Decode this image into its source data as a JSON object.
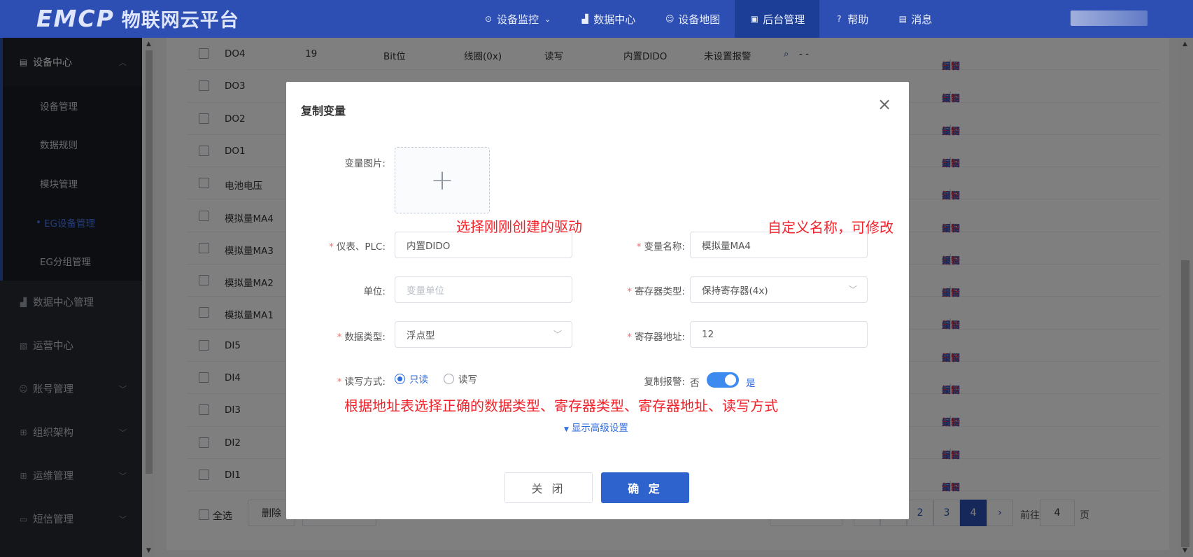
{
  "header": {
    "logo_text": "EMCP",
    "logo_cn": "物联网云平台",
    "nav": [
      {
        "label": "设备监控",
        "icon": "location-icon",
        "has_dropdown": true
      },
      {
        "label": "数据中心",
        "icon": "chart-icon"
      },
      {
        "label": "设备地图",
        "icon": "user-icon"
      },
      {
        "label": "后台管理",
        "icon": "monitor-icon",
        "active": true
      },
      {
        "label": "帮助",
        "icon": "help-icon"
      },
      {
        "label": "消息",
        "icon": "message-icon"
      }
    ]
  },
  "sidebar": {
    "open_group": "设备中心",
    "sub_items": [
      "设备管理",
      "数据规则",
      "模块管理",
      "EG设备管理",
      "EG分组管理"
    ],
    "active_sub": "EG设备管理",
    "groups": [
      {
        "label": "数据中心管理",
        "has_children": false
      },
      {
        "label": "运营中心",
        "has_children": false
      },
      {
        "label": "账号管理",
        "has_children": true
      },
      {
        "label": "组织架构",
        "has_children": true
      },
      {
        "label": "运维管理",
        "has_children": true
      },
      {
        "label": "短信管理",
        "has_children": true
      }
    ]
  },
  "table": {
    "rows": [
      {
        "name": "DO4",
        "address": "19",
        "data_type": "Bit位",
        "register": "线圈(0x)",
        "rw": "读写",
        "plc": "内置DIDO",
        "alarm": "未设置报警",
        "extra": "- -"
      },
      {
        "name": "DO3"
      },
      {
        "name": "DO2"
      },
      {
        "name": "DO1"
      },
      {
        "name": "电池电压"
      },
      {
        "name": "模拟量MA4"
      },
      {
        "name": "模拟量MA3"
      },
      {
        "name": "模拟量MA2"
      },
      {
        "name": "模拟量MA1"
      },
      {
        "name": "DI5"
      },
      {
        "name": "DI4"
      },
      {
        "name": "DI3"
      },
      {
        "name": "DI2"
      },
      {
        "name": "DI1"
      }
    ],
    "actions": {
      "edit": "编辑",
      "alarm": "报警",
      "copy": "复制",
      "delete": "删除"
    }
  },
  "footer": {
    "select_all": "全选",
    "delete": "删除",
    "pages": [
      "1",
      "2",
      "3",
      "4"
    ],
    "current_page": "4",
    "goto_label": "前往",
    "goto_value": "4",
    "page_suffix": "页"
  },
  "modal": {
    "title": "复制变量",
    "close_icon": "×",
    "image_label": "变量图片:",
    "plc_label": "仪表、PLC:",
    "plc_value": "内置DIDO",
    "var_name_label": "变量名称:",
    "var_name_value": "模拟量MA4",
    "unit_label": "单位:",
    "unit_placeholder": "变量单位",
    "register_type_label": "寄存器类型:",
    "register_type_value": "保持寄存器(4x)",
    "data_type_label": "数据类型:",
    "data_type_value": "浮点型",
    "register_addr_label": "寄存器地址:",
    "register_addr_value": "12",
    "rw_label": "读写方式:",
    "rw_options": [
      "只读",
      "读写"
    ],
    "rw_selected": "只读",
    "copy_alarm_label": "复制报警:",
    "toggle_off": "否",
    "toggle_on": "是",
    "toggle_state": true,
    "advanced": "显示高级设置",
    "btn_close": "关 闭",
    "btn_ok": "确 定"
  },
  "annotations": {
    "driver_note": "选择刚刚创建的驱动",
    "name_note": "自定义名称，可修改",
    "main_note": "根据地址表选择正确的数据类型、寄存器类型、寄存器地址、读写方式"
  },
  "colors": {
    "brand": "#2d4fb3",
    "annotation": "#f0232b",
    "primary_button": "#2e62cc",
    "delete": "#e0323b"
  }
}
